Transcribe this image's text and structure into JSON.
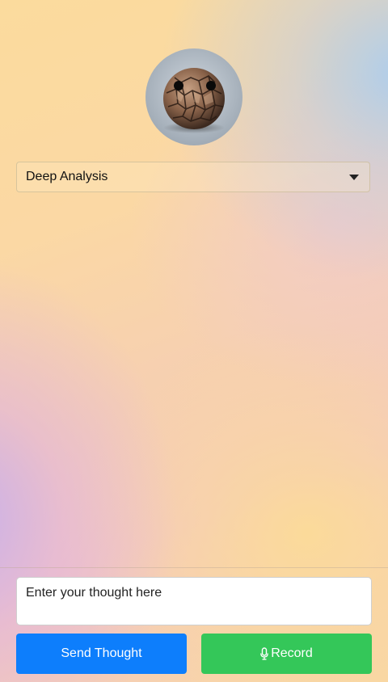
{
  "mode_select": {
    "selected": "Deep Analysis"
  },
  "composer": {
    "placeholder": "Enter your thought here",
    "send_label": "Send Thought",
    "record_label": "Record"
  },
  "icons": {
    "avatar": "rock-face-avatar",
    "dropdown": "caret-down-icon",
    "mic": "microphone-icon"
  },
  "colors": {
    "send_button": "#0d7efc",
    "record_button": "#34c759"
  }
}
